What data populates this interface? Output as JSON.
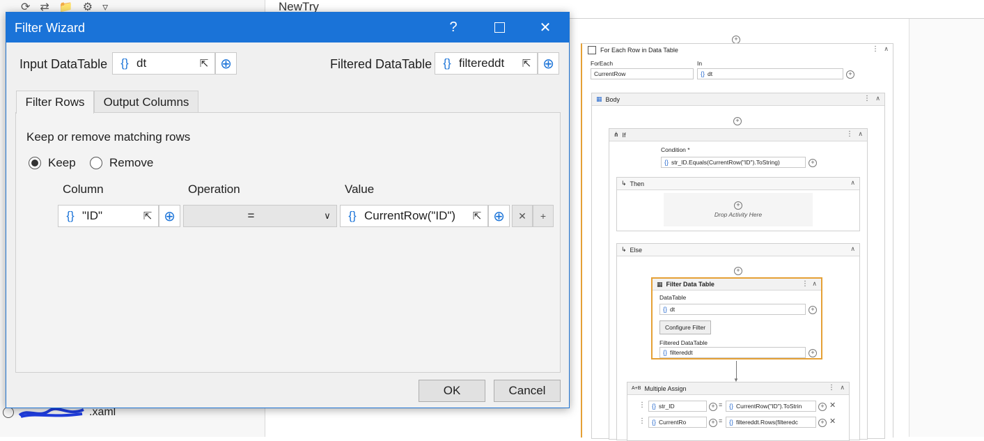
{
  "studio": {
    "tab_title": "NewTry",
    "file_item": ".xaml"
  },
  "designer": {
    "foreach": {
      "title": "For Each Row in Data Table",
      "foreach_label": "ForEach",
      "foreach_value": "CurrentRow",
      "in_label": "In",
      "in_value": "dt"
    },
    "body": {
      "title": "Body"
    },
    "if": {
      "title": "If",
      "condition_label": "Condition *",
      "condition_value": "str_ID.Equals(CurrentRow(\"ID\").ToString)"
    },
    "then": {
      "title": "Then",
      "drop_text": "Drop Activity Here"
    },
    "else": {
      "title": "Else"
    },
    "filter": {
      "title": "Filter Data Table",
      "datatable_label": "DataTable",
      "datatable_value": "dt",
      "configure_button": "Configure Filter",
      "filtered_label": "Filtered DataTable",
      "filtered_value": "filtereddt"
    },
    "multi_assign": {
      "title": "Multiple Assign",
      "rows": [
        {
          "left": "str_ID",
          "right": "CurrentRow(\"ID\").ToStrin"
        },
        {
          "left": "CurrentRo",
          "right": "filtereddt.Rows(filteredc"
        }
      ],
      "eq": "="
    }
  },
  "dialog": {
    "title": "Filter Wizard",
    "help": "?",
    "input_label": "Input DataTable",
    "input_value": "dt",
    "filtered_label": "Filtered DataTable",
    "filtered_value": "filtereddt",
    "tabs": [
      "Filter Rows",
      "Output Columns"
    ],
    "section_title": "Keep or remove matching rows",
    "radio_keep": "Keep",
    "radio_remove": "Remove",
    "columns": {
      "column": "Column",
      "operation": "Operation",
      "value": "Value"
    },
    "row": {
      "column": "\"ID\"",
      "operation": "=",
      "value": "CurrentRow(\"ID\")"
    },
    "ok": "OK",
    "cancel": "Cancel",
    "braces": "{}"
  }
}
